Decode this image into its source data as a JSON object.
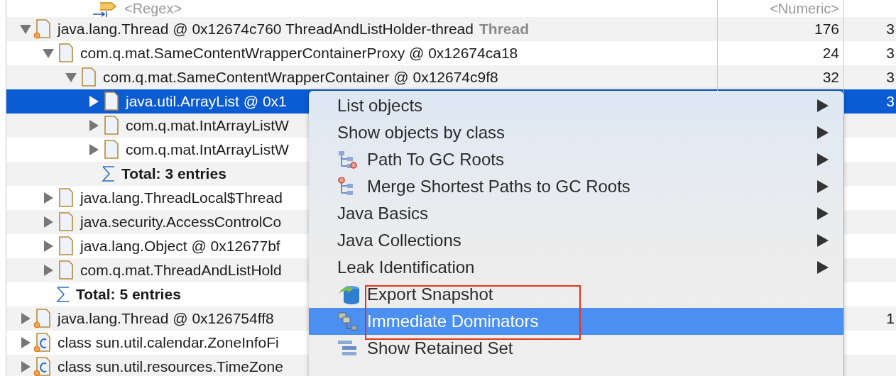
{
  "filter_row": {
    "name_placeholder": "<Regex>",
    "numeric_placeholder": "<Numeric>"
  },
  "tree": [
    {
      "kind": "object",
      "marker": true,
      "label": "java.lang.Thread @ 0x12674c760  ThreadAndListHolder-thread",
      "tag": "Thread",
      "shallow": "176",
      "column_3": "3",
      "expanded": true,
      "selected": false,
      "children": [
        {
          "kind": "object",
          "label": "com.q.mat.SameContentWrapperContainerProxy @ 0x12674ca18",
          "shallow": "24",
          "column_3": "3",
          "expanded": true,
          "selected": false,
          "children": [
            {
              "kind": "object",
              "label": "com.q.mat.SameContentWrapperContainer @ 0x12674c9f8",
              "shallow": "32",
              "column_3": "3",
              "expanded": true,
              "selected": false,
              "children": [
                {
                  "kind": "object",
                  "label": "java.util.ArrayList @ 0x1",
                  "column_3": "3",
                  "expanded": false,
                  "selected": true
                },
                {
                  "kind": "object",
                  "label": "com.q.mat.IntArrayListW",
                  "expanded": false,
                  "selected": false
                },
                {
                  "kind": "object",
                  "label": "com.q.mat.IntArrayListW",
                  "expanded": false,
                  "selected": false
                },
                {
                  "kind": "total",
                  "label": "Total: 3 entries",
                  "selected": false
                }
              ]
            }
          ]
        },
        {
          "kind": "object",
          "label": "java.lang.ThreadLocal$Thread",
          "expanded": false,
          "selected": false
        },
        {
          "kind": "object",
          "label": "java.security.AccessControlCo",
          "expanded": false,
          "selected": false
        },
        {
          "kind": "object",
          "label": "java.lang.Object @ 0x12677bf",
          "expanded": false,
          "selected": false
        },
        {
          "kind": "object",
          "label": "com.q.mat.ThreadAndListHold",
          "expanded": false,
          "selected": false
        },
        {
          "kind": "total",
          "label": "Total: 5 entries",
          "selected": false
        }
      ]
    },
    {
      "kind": "object",
      "marker": true,
      "label": "java.lang.Thread @ 0x126754ff8",
      "column_3": "1",
      "expanded": false,
      "selected": false
    },
    {
      "kind": "class",
      "marker": true,
      "label": "class sun.util.calendar.ZoneInfoFi",
      "expanded": false,
      "selected": false
    },
    {
      "kind": "class",
      "marker": true,
      "label": "class sun.util.resources.TimeZone",
      "expanded": false,
      "selected": false
    }
  ],
  "context_menu": [
    {
      "kind": "plain",
      "label": "List objects",
      "submenu": true,
      "selected": false
    },
    {
      "kind": "plain",
      "label": "Show objects by class",
      "submenu": true,
      "selected": false
    },
    {
      "kind": "path",
      "label": "Path To GC Roots",
      "submenu": true,
      "selected": false
    },
    {
      "kind": "merge",
      "label": "Merge Shortest Paths to GC Roots",
      "submenu": true,
      "selected": false
    },
    {
      "kind": "plain",
      "label": "Java Basics",
      "submenu": true,
      "selected": false
    },
    {
      "kind": "plain",
      "label": "Java Collections",
      "submenu": true,
      "selected": false
    },
    {
      "kind": "plain",
      "label": "Leak Identification",
      "submenu": true,
      "selected": false
    },
    {
      "kind": "export",
      "label": "Export Snapshot",
      "submenu": false,
      "selected": false
    },
    {
      "kind": "dominators",
      "label": "Immediate Dominators",
      "submenu": false,
      "selected": true
    },
    {
      "kind": "retained",
      "label": "Show Retained Set",
      "submenu": false,
      "selected": false
    }
  ]
}
